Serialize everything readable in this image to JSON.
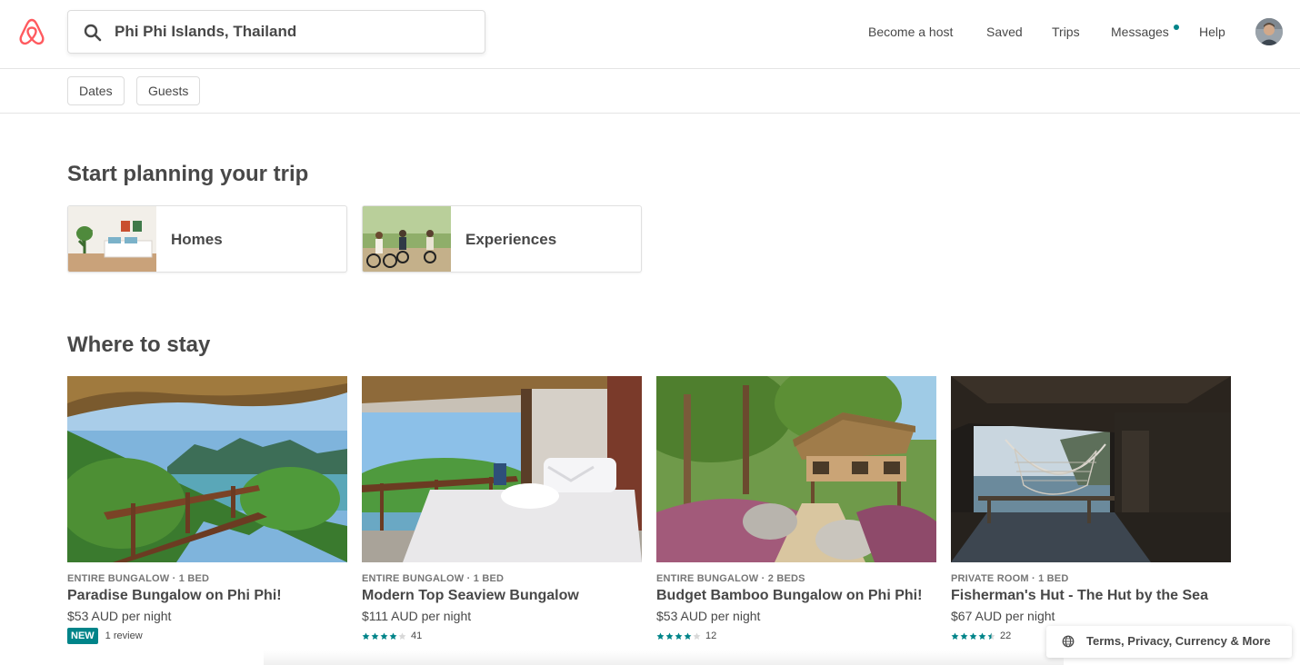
{
  "brand": {
    "accent": "#FF5A5F",
    "teal": "#008489",
    "logo_icon": "airbnb-logo"
  },
  "search": {
    "value": "Phi Phi Islands, Thailand",
    "icon": "search-icon"
  },
  "nav": {
    "become_host": "Become a host",
    "saved": "Saved",
    "trips": "Trips",
    "messages": "Messages",
    "help": "Help"
  },
  "filters": {
    "dates": "Dates",
    "guests": "Guests"
  },
  "planning": {
    "title": "Start planning your trip",
    "categories": [
      {
        "label": "Homes"
      },
      {
        "label": "Experiences"
      }
    ]
  },
  "stay": {
    "title": "Where to stay",
    "listings": [
      {
        "type": "ENTIRE BUNGALOW · 1 BED",
        "title": "Paradise Bungalow on Phi Phi!",
        "price": "$53 AUD per night",
        "badge": "NEW",
        "reviews": "1 review"
      },
      {
        "type": "ENTIRE BUNGALOW · 1 BED",
        "title": "Modern Top Seaview Bungalow",
        "price": "$111 AUD per night",
        "rating": 4,
        "reviews": "41"
      },
      {
        "type": "ENTIRE BUNGALOW · 2 BEDS",
        "title": "Budget Bamboo Bungalow on Phi Phi!",
        "price": "$53 AUD per night",
        "rating": 4,
        "reviews": "12"
      },
      {
        "type": "PRIVATE ROOM · 1 BED",
        "title": "Fisherman's Hut - The Hut by the Sea",
        "price": "$67 AUD per night",
        "rating": 4.5,
        "reviews": "22"
      }
    ]
  },
  "footer": {
    "label": "Terms, Privacy, Currency & More",
    "icon": "globe-icon"
  }
}
